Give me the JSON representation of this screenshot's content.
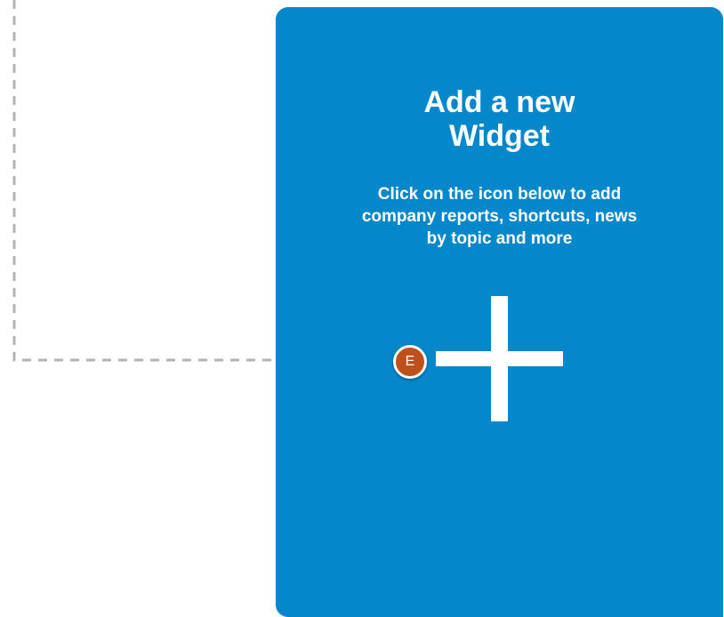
{
  "widget": {
    "title_line1": "Add a new",
    "title_line2": "Widget",
    "description_line1": "Click on the icon below to add",
    "description_line2": "company reports, shortcuts, news",
    "description_line3": "by topic and more",
    "add_icon": "plus-icon",
    "background_color": "#0588cb"
  },
  "callout": {
    "marker_label": "E",
    "marker_color": "#c0501b"
  }
}
